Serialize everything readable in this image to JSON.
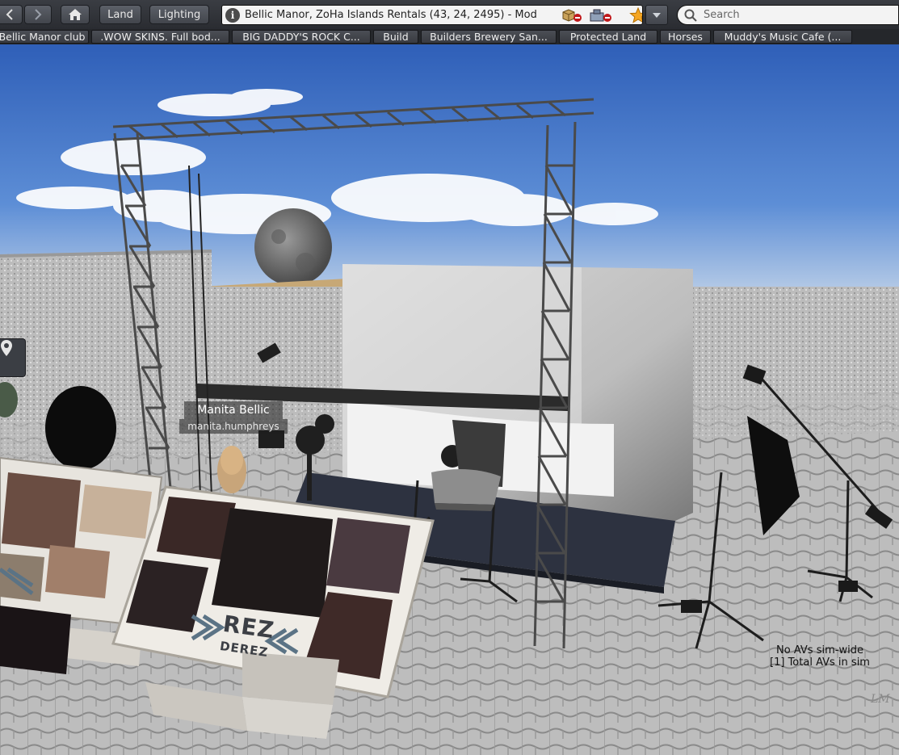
{
  "toolbar": {
    "land_label": "Land",
    "lighting_label": "Lighting",
    "location": "Bellic Manor, ZoHa Islands Rentals (43, 24, 2495) - Mod",
    "search_placeholder": "Search"
  },
  "favorites": [
    "Bellic Manor club",
    ".WOW SKINS. Full bod...",
    "BIG DADDY'S ROCK C...",
    "Build",
    "Builders Brewery San...",
    "Protected Land",
    "Horses",
    "Muddy's Music Cafe (..."
  ],
  "avatar": {
    "display_name": "Manita Bellic",
    "username": "manita.humphreys"
  },
  "sim_status": {
    "line1": "No AVs sim-wide",
    "line2": "[1] Total AVs in sim"
  },
  "sign": {
    "title": "REZ",
    "subtitle": "DEREZ"
  },
  "watermark": "LM",
  "icons": [
    "back-icon",
    "forward-icon",
    "home-icon",
    "info-icon",
    "no-build-icon",
    "no-scripts-icon",
    "favorite-star-icon",
    "dropdown-icon",
    "search-icon",
    "map-pin-icon"
  ],
  "colors": {
    "toolbar": "#2f3237",
    "star": "#f5a623",
    "sky": "#3a6fc4"
  }
}
